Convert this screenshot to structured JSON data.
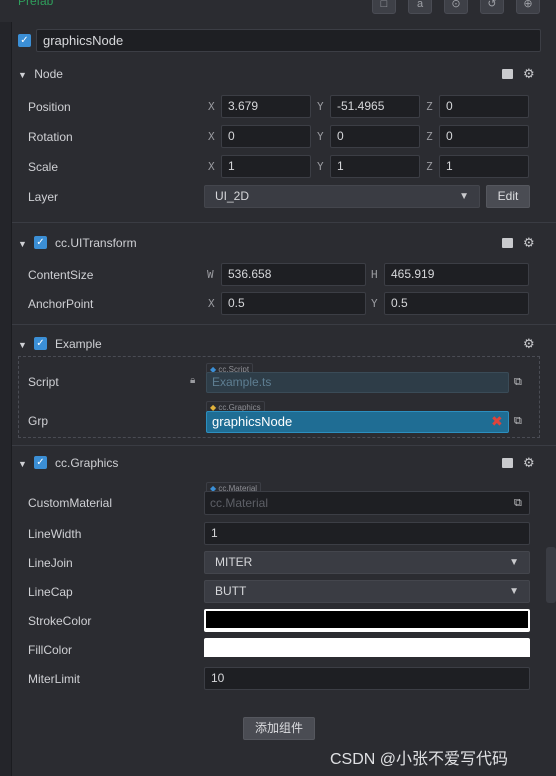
{
  "header": {
    "prefab_label": "Prefab"
  },
  "node_name": {
    "value": "graphicsNode"
  },
  "node_section": {
    "title": "Node",
    "position": {
      "label": "Position",
      "x_axis": "X",
      "x": "3.679",
      "y_axis": "Y",
      "y": "-51.4965",
      "z_axis": "Z",
      "z": "0"
    },
    "rotation": {
      "label": "Rotation",
      "x_axis": "X",
      "x": "0",
      "y_axis": "Y",
      "y": "0",
      "z_axis": "Z",
      "z": "0"
    },
    "scale": {
      "label": "Scale",
      "x_axis": "X",
      "x": "1",
      "y_axis": "Y",
      "y": "1",
      "z_axis": "Z",
      "z": "1"
    },
    "layer": {
      "label": "Layer",
      "value": "UI_2D",
      "edit_label": "Edit"
    }
  },
  "uitransform": {
    "title": "cc.UITransform",
    "content_size": {
      "label": "ContentSize",
      "w_axis": "W",
      "w": "536.658",
      "h_axis": "H",
      "h": "465.919"
    },
    "anchor_point": {
      "label": "AnchorPoint",
      "x_axis": "X",
      "x": "0.5",
      "y_axis": "Y",
      "y": "0.5"
    }
  },
  "example": {
    "title": "Example",
    "script": {
      "label": "Script",
      "tag": "cc.Script",
      "value": "Example.ts"
    },
    "grp": {
      "label": "Grp",
      "tag": "cc.Graphics",
      "value": "graphicsNode"
    }
  },
  "graphics": {
    "title": "cc.Graphics",
    "custom_material": {
      "label": "CustomMaterial",
      "tag": "cc.Material",
      "placeholder": "cc.Material"
    },
    "line_width": {
      "label": "LineWidth",
      "value": "1"
    },
    "line_join": {
      "label": "LineJoin",
      "value": "MITER"
    },
    "line_cap": {
      "label": "LineCap",
      "value": "BUTT"
    },
    "stroke_color": {
      "label": "StrokeColor",
      "color": "#000000"
    },
    "fill_color": {
      "label": "FillColor",
      "color": "#ffffff"
    },
    "miter_limit": {
      "label": "MiterLimit",
      "value": "10"
    }
  },
  "add_component": {
    "label": "添加组件"
  },
  "watermark": {
    "text": "CSDN @小张不爱写代码"
  },
  "colors": {
    "accent": "#3b8fd6",
    "selected_field": "#1f6d94",
    "prefab_green": "#2f9e5c",
    "remove_red": "#e0443b"
  }
}
